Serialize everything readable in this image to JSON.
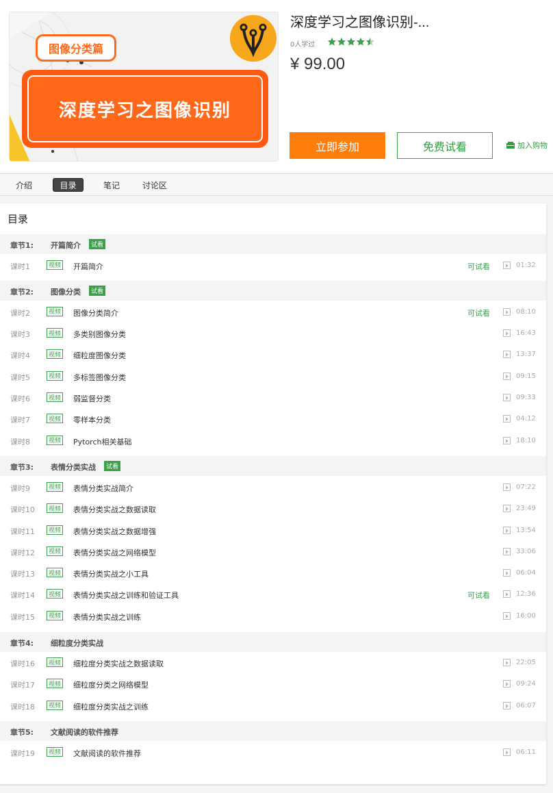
{
  "course": {
    "title": "深度学习之图像识别-...",
    "learners": "0人学过",
    "rating": 4.5,
    "price": "¥ 99.00",
    "cover_tag": "图像分类篇",
    "cover_title": "深度学习之图像识别"
  },
  "actions": {
    "join": "立即参加",
    "trial": "免费试看",
    "cart": "加入购物"
  },
  "colors": {
    "accent": "#ff7d0a",
    "green": "#3aa14a"
  },
  "tabs": [
    {
      "label": "介绍",
      "active": false
    },
    {
      "label": "目录",
      "active": true
    },
    {
      "label": "笔记",
      "active": false
    },
    {
      "label": "讨论区",
      "active": false
    }
  ],
  "catalog": {
    "title": "目录",
    "chapters": [
      {
        "num": "章节1:",
        "name": "开篇简介",
        "badge": "试看",
        "lessons": [
          {
            "num": "课时1",
            "tag": "视频",
            "title": "开篇简介",
            "preview": "可试看",
            "dur": "01:32"
          }
        ]
      },
      {
        "num": "章节2:",
        "name": "图像分类",
        "badge": "试看",
        "lessons": [
          {
            "num": "课时2",
            "tag": "视频",
            "title": "图像分类简介",
            "preview": "可试看",
            "dur": "08:10"
          },
          {
            "num": "课时3",
            "tag": "视频",
            "title": "多类别图像分类",
            "preview": "",
            "dur": "16:43"
          },
          {
            "num": "课时4",
            "tag": "视频",
            "title": "细粒度图像分类",
            "preview": "",
            "dur": "13:37"
          },
          {
            "num": "课时5",
            "tag": "视频",
            "title": "多标签图像分类",
            "preview": "",
            "dur": "09:15"
          },
          {
            "num": "课时6",
            "tag": "视频",
            "title": "弱监督分类",
            "preview": "",
            "dur": "09:33"
          },
          {
            "num": "课时7",
            "tag": "视频",
            "title": "零样本分类",
            "preview": "",
            "dur": "04:12"
          },
          {
            "num": "课时8",
            "tag": "视频",
            "title": "Pytorch相关基础",
            "preview": "",
            "dur": "18:10"
          }
        ]
      },
      {
        "num": "章节3:",
        "name": "表情分类实战",
        "badge": "试看",
        "lessons": [
          {
            "num": "课时9",
            "tag": "视频",
            "title": "表情分类实战简介",
            "preview": "",
            "dur": "07:22"
          },
          {
            "num": "课时10",
            "tag": "视频",
            "title": "表情分类实战之数据读取",
            "preview": "",
            "dur": "23:49"
          },
          {
            "num": "课时11",
            "tag": "视频",
            "title": "表情分类实战之数据增强",
            "preview": "",
            "dur": "13:54"
          },
          {
            "num": "课时12",
            "tag": "视频",
            "title": "表情分类实战之网络模型",
            "preview": "",
            "dur": "33:06"
          },
          {
            "num": "课时13",
            "tag": "视频",
            "title": "表情分类实战之小工具",
            "preview": "",
            "dur": "06:04"
          },
          {
            "num": "课时14",
            "tag": "视频",
            "title": "表情分类实战之训练和验证工具",
            "preview": "可试看",
            "dur": "12:36"
          },
          {
            "num": "课时15",
            "tag": "视频",
            "title": "表情分类实战之训练",
            "preview": "",
            "dur": "16:00"
          }
        ]
      },
      {
        "num": "章节4:",
        "name": "细粒度分类实战",
        "badge": "",
        "lessons": [
          {
            "num": "课时16",
            "tag": "视频",
            "title": "细粒度分类实战之数据读取",
            "preview": "",
            "dur": "22:05"
          },
          {
            "num": "课时17",
            "tag": "视频",
            "title": "细粒度分类之网络模型",
            "preview": "",
            "dur": "09:24"
          },
          {
            "num": "课时18",
            "tag": "视频",
            "title": "细粒度分类实战之训练",
            "preview": "",
            "dur": "06:07"
          }
        ]
      },
      {
        "num": "章节5:",
        "name": "文献阅读的软件推荐",
        "badge": "",
        "lessons": [
          {
            "num": "课时19",
            "tag": "视频",
            "title": "文献阅读的软件推荐",
            "preview": "",
            "dur": "06:11"
          }
        ]
      }
    ]
  }
}
